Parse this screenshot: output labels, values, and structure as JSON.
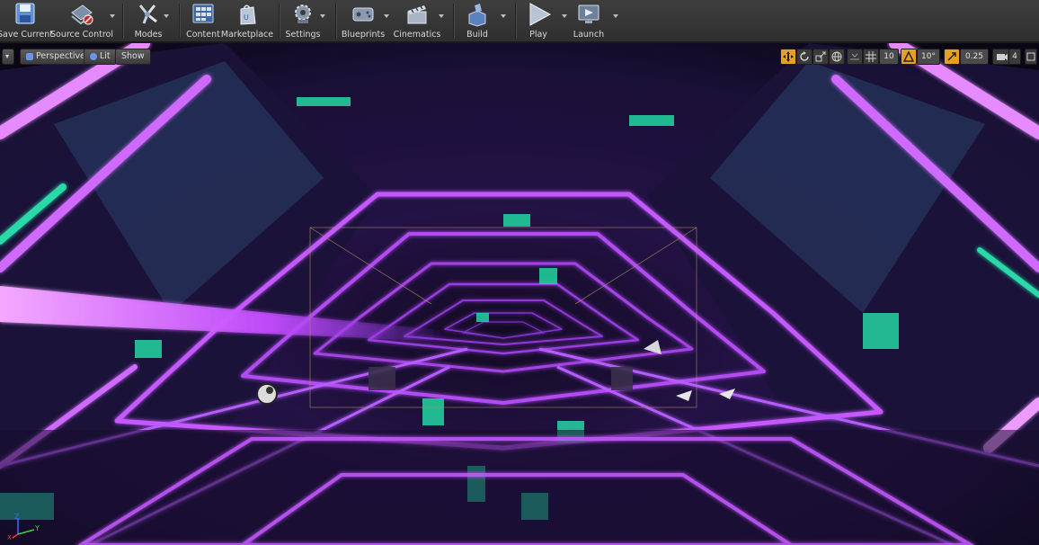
{
  "toolbar": {
    "save_current": "Save Current",
    "source_control": "Source Control",
    "modes": "Modes",
    "content": "Content",
    "marketplace": "Marketplace",
    "settings": "Settings",
    "blueprints": "Blueprints",
    "cinematics": "Cinematics",
    "build": "Build",
    "play": "Play",
    "launch": "Launch"
  },
  "viewport": {
    "perspective_label": "Perspective",
    "lit_label": "Lit",
    "show_label": "Show",
    "grid_snap_value": "10",
    "rotation_snap_value": "10°",
    "scale_snap_value": "0.25",
    "camera_speed_value": "4",
    "axis_z": "Z",
    "axis_y": "Y",
    "axis_x": "X"
  },
  "colors": {
    "accent_orange": "#e8a020",
    "neon_purple": "#c052ff",
    "neon_teal": "#28e0b0"
  }
}
